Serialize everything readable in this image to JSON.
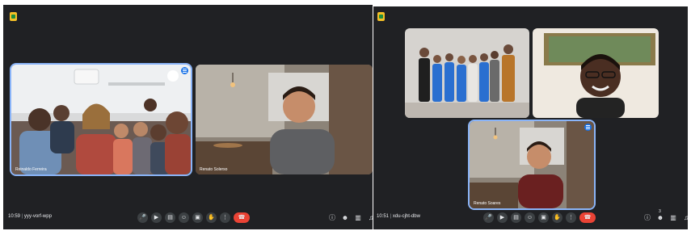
{
  "left_call": {
    "time": "10:59",
    "meeting_code": "yyy-vorf-wpp",
    "participants": [
      "Reinaldo Ferreira",
      "Renato Solerso"
    ]
  },
  "right_call": {
    "time": "10:51",
    "meeting_code": "xdu-cjht-dbw",
    "participant_name": "Renato Soares",
    "people_count": "3"
  },
  "controls": [
    "mic-icon",
    "camera-icon",
    "captions-icon",
    "emoji-icon",
    "present-icon",
    "hand-icon",
    "more-icon",
    "hangup-icon"
  ],
  "right_tools": [
    "info-icon",
    "people-icon",
    "chat-icon",
    "activities-icon"
  ],
  "colors": {
    "background": "#202124",
    "hangup": "#ea4335",
    "active_border": "#8ab4f8",
    "logo": "#f6c026"
  }
}
